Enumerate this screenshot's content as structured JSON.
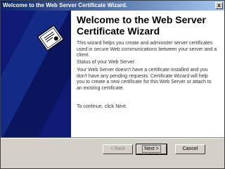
{
  "window": {
    "title": "Welcome to the Web Server Certificate Wizard.",
    "close_glyph": "x"
  },
  "wizard": {
    "heading": "Welcome to the Web Server Certificate Wizard",
    "intro": "This wizard helps you create and administer server certificates used in secure Web communications between your server and a client.",
    "status_label": "Status of your Web Server:",
    "status_text": "Your Web Server doesn't have a certificate installed and you don't have any pending requests. Certificate Wizard will help you to create a new certificate for this Web Server or attach to an existing certificate.",
    "continue_text": "To continue, click Next."
  },
  "buttons": {
    "back": "< Back",
    "next": "Next >",
    "cancel": "Cancel"
  },
  "colors": {
    "banner": "#0d1b74",
    "title_start": "#0a246a",
    "title_end": "#a6caf0"
  },
  "icons": {
    "banner_icon": "certificate-icon"
  }
}
